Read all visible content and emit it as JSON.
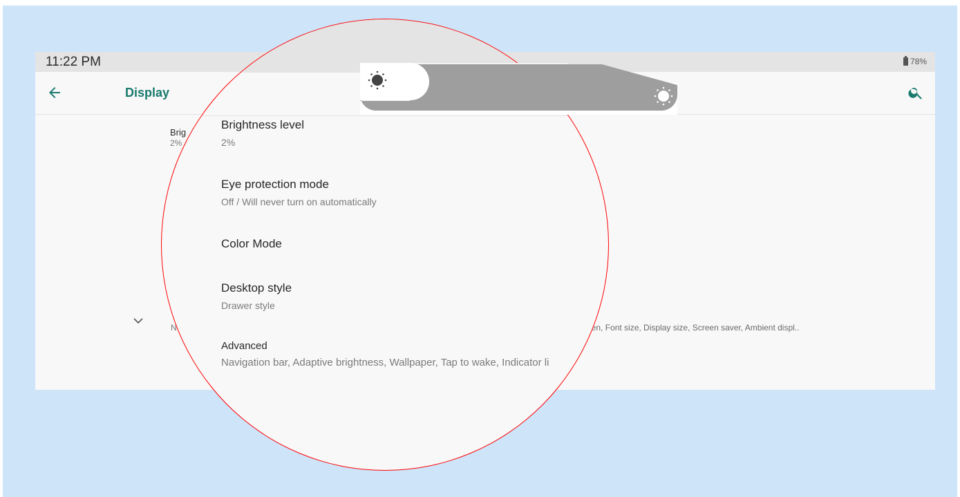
{
  "status": {
    "time": "11:22 PM",
    "battery": "78%"
  },
  "toolbar": {
    "title": "Display",
    "back_icon": "arrow-back-icon",
    "search_icon": "search-icon"
  },
  "background": {
    "brightness_title_partial": "Brig",
    "brightness_value_partial": "2%",
    "advanced_partial": "N",
    "advanced_text_partial": "een, Font size, Display size, Screen saver, Ambient displ.."
  },
  "slider": {
    "low_icon": "brightness-low-icon",
    "high_icon": "brightness-high-icon",
    "level_percent": 2
  },
  "menu": {
    "brightness": {
      "title": "Brightness level",
      "value": "2%"
    },
    "eye_protection": {
      "title": "Eye protection mode",
      "value": "Off / Will never turn on automatically"
    },
    "color_mode": {
      "title": "Color Mode"
    },
    "desktop_style": {
      "title": "Desktop style",
      "value": "Drawer style"
    },
    "advanced": {
      "title": "Advanced",
      "value": "Navigation bar, Adaptive brightness, Wallpaper, Tap to wake, Indicator li"
    }
  },
  "colors": {
    "accent": "#1a7a6e",
    "highlight_circle": "#ff0000",
    "frame_bg": "#cde4f9"
  }
}
